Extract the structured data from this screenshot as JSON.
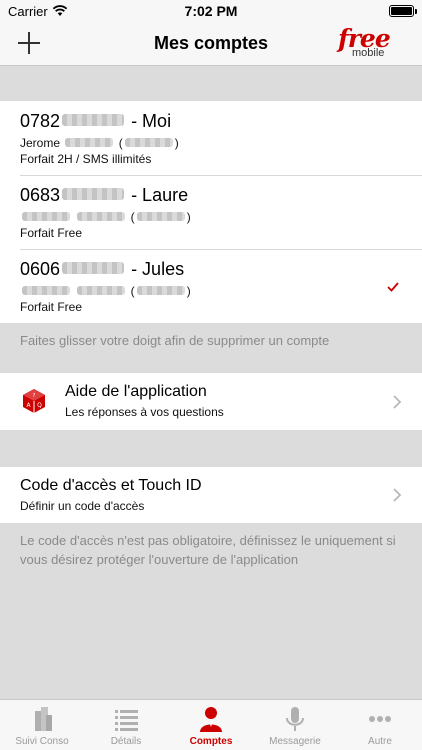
{
  "status_bar": {
    "carrier": "Carrier",
    "time": "7:02 PM"
  },
  "nav": {
    "title": "Mes comptes",
    "logo_top": "free",
    "logo_bottom": "mobile"
  },
  "accounts": [
    {
      "phone_prefix": "0782",
      "name": "- Moi",
      "holder_first": "Jerome",
      "plan": "Forfait 2H / SMS illimités",
      "selected": false
    },
    {
      "phone_prefix": "0683",
      "name": "- Laure",
      "holder_first": "",
      "plan": "Forfait Free",
      "selected": false
    },
    {
      "phone_prefix": "0606",
      "name": "- Jules",
      "holder_first": "",
      "plan": "Forfait Free",
      "selected": true
    }
  ],
  "swipe_hint": "Faites glisser votre doigt afin de supprimer un compte",
  "help": {
    "title": "Aide de l'application",
    "subtitle": "Les réponses à vos questions",
    "icon": "help-dice-icon"
  },
  "security": {
    "title": "Code d'accès et Touch ID",
    "subtitle": "Définir un code d'accès"
  },
  "security_hint": "Le code d'accès n'est pas obligatoire, définissez le uniquement si vous désirez protéger l'ouverture de l'application",
  "tabs": [
    {
      "label": "Suivi Conso",
      "icon": "buildings-icon",
      "active": false
    },
    {
      "label": "Détails",
      "icon": "list-icon",
      "active": false
    },
    {
      "label": "Comptes",
      "icon": "user-icon",
      "active": true
    },
    {
      "label": "Messagerie",
      "icon": "microphone-icon",
      "active": false
    },
    {
      "label": "Autre",
      "icon": "more-dots-icon",
      "active": false
    }
  ],
  "colors": {
    "accent": "#cc0000",
    "background": "#dcdcdc",
    "hint_text": "#8a8a8a"
  }
}
